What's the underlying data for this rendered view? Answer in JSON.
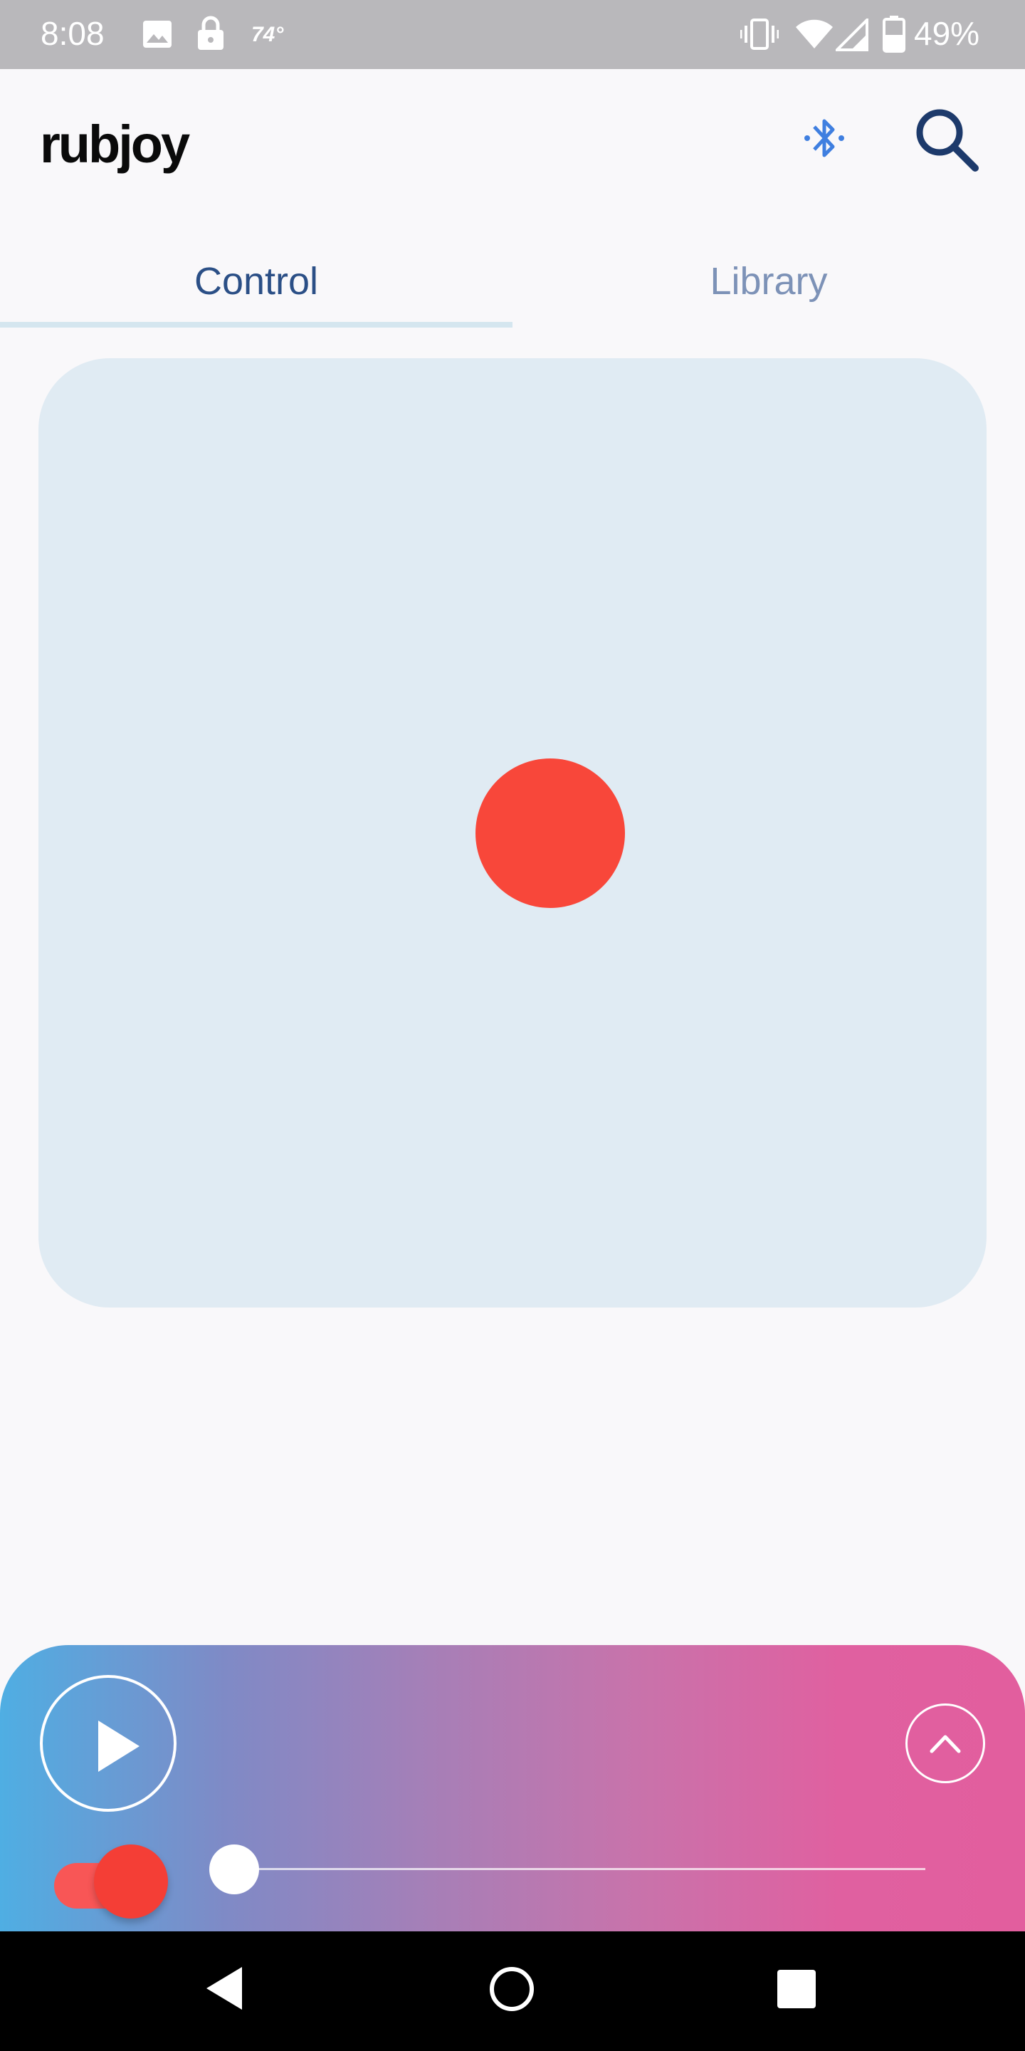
{
  "status_bar": {
    "time": "8:08",
    "temperature": "74°",
    "battery_percent": "49%",
    "icons": [
      "image-icon",
      "lock-icon",
      "vibrate-icon",
      "wifi-icon",
      "signal-icon",
      "battery-icon"
    ]
  },
  "app_bar": {
    "logo": "rubjoy",
    "icons": [
      "bluetooth-icon",
      "search-icon"
    ],
    "bluetooth_color": "#3f7fe0"
  },
  "tabs": [
    {
      "label": "Control",
      "selected": true
    },
    {
      "label": "Library",
      "selected": false
    }
  ],
  "control_pad": {
    "dot_color": "#f8473a",
    "background": "#e0ebf3"
  },
  "player": {
    "icons": [
      "play-icon",
      "chevron-up-icon"
    ],
    "toggle_on": true,
    "slider_value": 0,
    "gradient": [
      "#4faee3",
      "#a67fb7",
      "#e25e9e"
    ]
  },
  "nav_bar": {
    "icons": [
      "back-icon",
      "home-icon",
      "recents-icon"
    ]
  }
}
